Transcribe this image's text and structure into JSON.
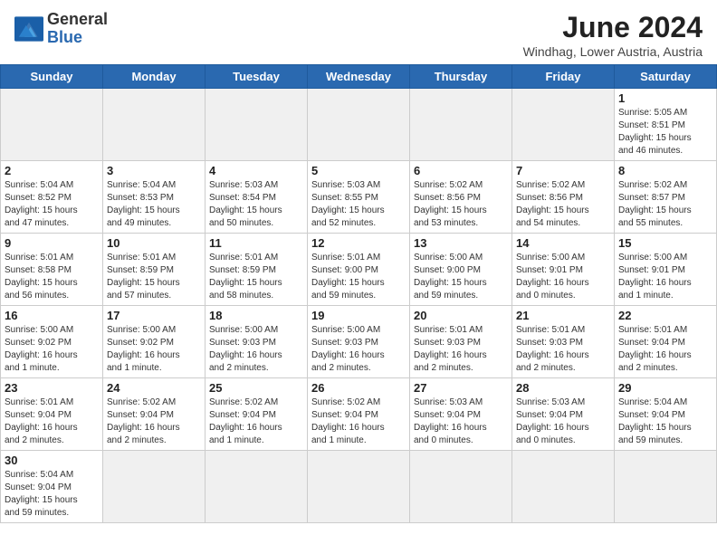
{
  "header": {
    "logo_general": "General",
    "logo_blue": "Blue",
    "month": "June 2024",
    "location": "Windhag, Lower Austria, Austria"
  },
  "days_of_week": [
    "Sunday",
    "Monday",
    "Tuesday",
    "Wednesday",
    "Thursday",
    "Friday",
    "Saturday"
  ],
  "weeks": [
    [
      {
        "day": "",
        "info": ""
      },
      {
        "day": "",
        "info": ""
      },
      {
        "day": "",
        "info": ""
      },
      {
        "day": "",
        "info": ""
      },
      {
        "day": "",
        "info": ""
      },
      {
        "day": "",
        "info": ""
      },
      {
        "day": "1",
        "info": "Sunrise: 5:05 AM\nSunset: 8:51 PM\nDaylight: 15 hours\nand 46 minutes."
      }
    ],
    [
      {
        "day": "2",
        "info": "Sunrise: 5:04 AM\nSunset: 8:52 PM\nDaylight: 15 hours\nand 47 minutes."
      },
      {
        "day": "3",
        "info": "Sunrise: 5:04 AM\nSunset: 8:53 PM\nDaylight: 15 hours\nand 49 minutes."
      },
      {
        "day": "4",
        "info": "Sunrise: 5:03 AM\nSunset: 8:54 PM\nDaylight: 15 hours\nand 50 minutes."
      },
      {
        "day": "5",
        "info": "Sunrise: 5:03 AM\nSunset: 8:55 PM\nDaylight: 15 hours\nand 52 minutes."
      },
      {
        "day": "6",
        "info": "Sunrise: 5:02 AM\nSunset: 8:56 PM\nDaylight: 15 hours\nand 53 minutes."
      },
      {
        "day": "7",
        "info": "Sunrise: 5:02 AM\nSunset: 8:56 PM\nDaylight: 15 hours\nand 54 minutes."
      },
      {
        "day": "8",
        "info": "Sunrise: 5:02 AM\nSunset: 8:57 PM\nDaylight: 15 hours\nand 55 minutes."
      }
    ],
    [
      {
        "day": "9",
        "info": "Sunrise: 5:01 AM\nSunset: 8:58 PM\nDaylight: 15 hours\nand 56 minutes."
      },
      {
        "day": "10",
        "info": "Sunrise: 5:01 AM\nSunset: 8:59 PM\nDaylight: 15 hours\nand 57 minutes."
      },
      {
        "day": "11",
        "info": "Sunrise: 5:01 AM\nSunset: 8:59 PM\nDaylight: 15 hours\nand 58 minutes."
      },
      {
        "day": "12",
        "info": "Sunrise: 5:01 AM\nSunset: 9:00 PM\nDaylight: 15 hours\nand 59 minutes."
      },
      {
        "day": "13",
        "info": "Sunrise: 5:00 AM\nSunset: 9:00 PM\nDaylight: 15 hours\nand 59 minutes."
      },
      {
        "day": "14",
        "info": "Sunrise: 5:00 AM\nSunset: 9:01 PM\nDaylight: 16 hours\nand 0 minutes."
      },
      {
        "day": "15",
        "info": "Sunrise: 5:00 AM\nSunset: 9:01 PM\nDaylight: 16 hours\nand 1 minute."
      }
    ],
    [
      {
        "day": "16",
        "info": "Sunrise: 5:00 AM\nSunset: 9:02 PM\nDaylight: 16 hours\nand 1 minute."
      },
      {
        "day": "17",
        "info": "Sunrise: 5:00 AM\nSunset: 9:02 PM\nDaylight: 16 hours\nand 1 minute."
      },
      {
        "day": "18",
        "info": "Sunrise: 5:00 AM\nSunset: 9:03 PM\nDaylight: 16 hours\nand 2 minutes."
      },
      {
        "day": "19",
        "info": "Sunrise: 5:00 AM\nSunset: 9:03 PM\nDaylight: 16 hours\nand 2 minutes."
      },
      {
        "day": "20",
        "info": "Sunrise: 5:01 AM\nSunset: 9:03 PM\nDaylight: 16 hours\nand 2 minutes."
      },
      {
        "day": "21",
        "info": "Sunrise: 5:01 AM\nSunset: 9:03 PM\nDaylight: 16 hours\nand 2 minutes."
      },
      {
        "day": "22",
        "info": "Sunrise: 5:01 AM\nSunset: 9:04 PM\nDaylight: 16 hours\nand 2 minutes."
      }
    ],
    [
      {
        "day": "23",
        "info": "Sunrise: 5:01 AM\nSunset: 9:04 PM\nDaylight: 16 hours\nand 2 minutes."
      },
      {
        "day": "24",
        "info": "Sunrise: 5:02 AM\nSunset: 9:04 PM\nDaylight: 16 hours\nand 2 minutes."
      },
      {
        "day": "25",
        "info": "Sunrise: 5:02 AM\nSunset: 9:04 PM\nDaylight: 16 hours\nand 1 minute."
      },
      {
        "day": "26",
        "info": "Sunrise: 5:02 AM\nSunset: 9:04 PM\nDaylight: 16 hours\nand 1 minute."
      },
      {
        "day": "27",
        "info": "Sunrise: 5:03 AM\nSunset: 9:04 PM\nDaylight: 16 hours\nand 0 minutes."
      },
      {
        "day": "28",
        "info": "Sunrise: 5:03 AM\nSunset: 9:04 PM\nDaylight: 16 hours\nand 0 minutes."
      },
      {
        "day": "29",
        "info": "Sunrise: 5:04 AM\nSunset: 9:04 PM\nDaylight: 15 hours\nand 59 minutes."
      }
    ],
    [
      {
        "day": "30",
        "info": "Sunrise: 5:04 AM\nSunset: 9:04 PM\nDaylight: 15 hours\nand 59 minutes."
      },
      {
        "day": "",
        "info": ""
      },
      {
        "day": "",
        "info": ""
      },
      {
        "day": "",
        "info": ""
      },
      {
        "day": "",
        "info": ""
      },
      {
        "day": "",
        "info": ""
      },
      {
        "day": "",
        "info": ""
      }
    ]
  ]
}
